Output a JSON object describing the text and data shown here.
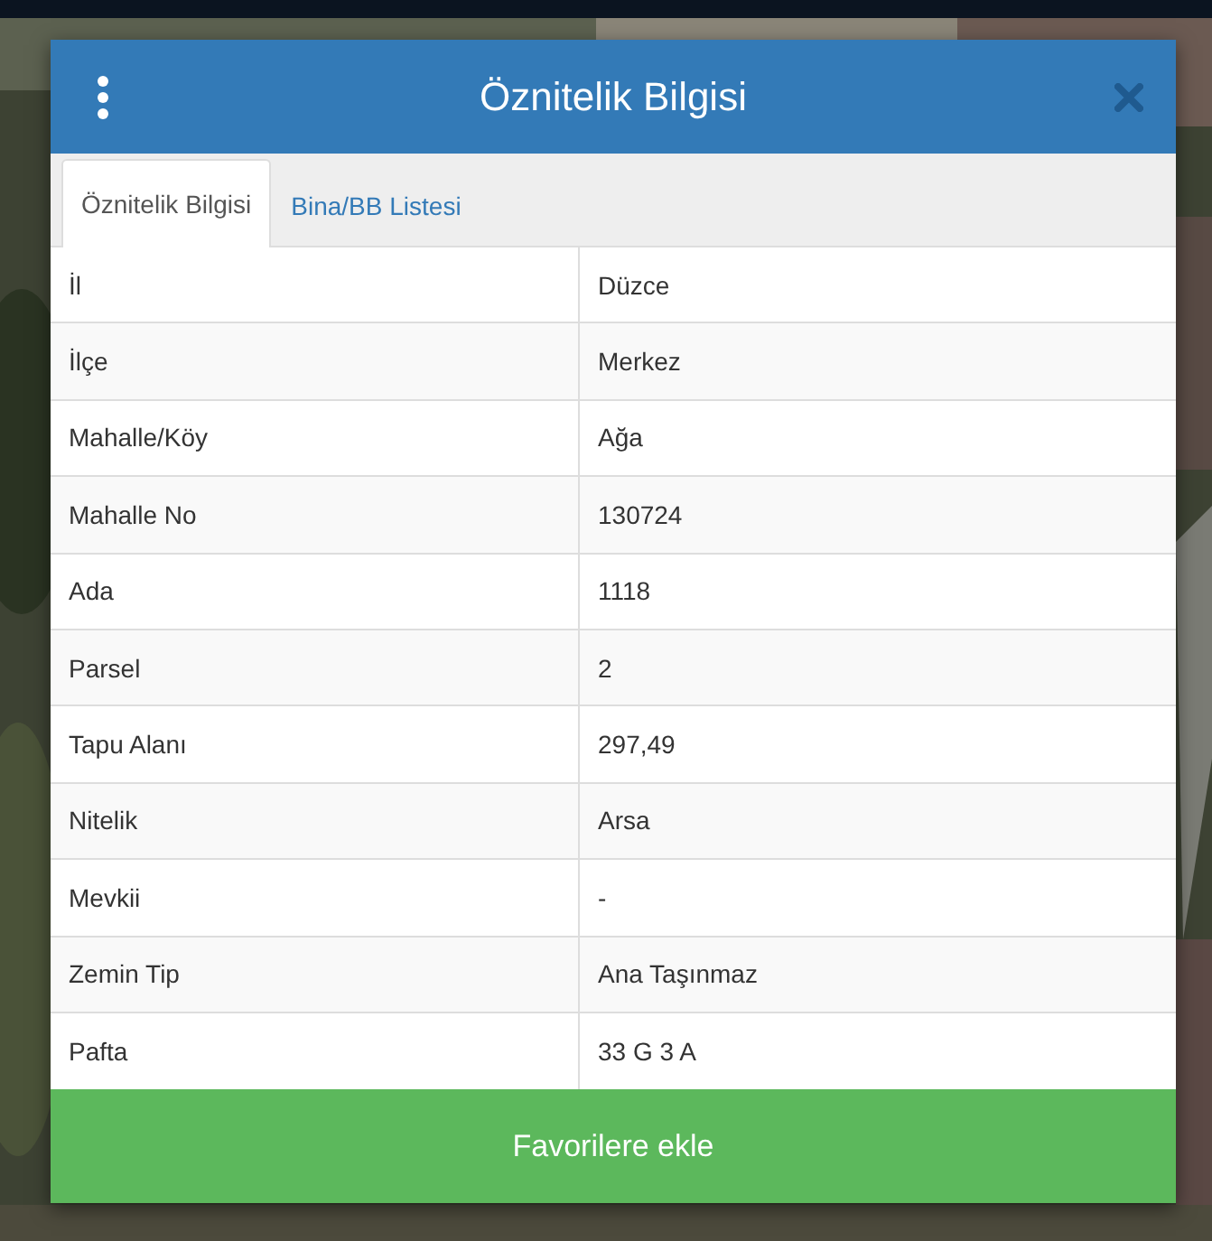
{
  "dialog": {
    "title": "Öznitelik Bilgisi",
    "tabs": [
      {
        "label": "Öznitelik Bilgisi",
        "selected": true
      },
      {
        "label": "Bina/BB Listesi",
        "selected": false
      }
    ],
    "rows": [
      {
        "label": "İl",
        "value": "Düzce"
      },
      {
        "label": "İlçe",
        "value": "Merkez"
      },
      {
        "label": "Mahalle/Köy",
        "value": "Ağa"
      },
      {
        "label": "Mahalle No",
        "value": "130724"
      },
      {
        "label": "Ada",
        "value": "1118"
      },
      {
        "label": "Parsel",
        "value": "2"
      },
      {
        "label": "Tapu Alanı",
        "value": "297,49"
      },
      {
        "label": "Nitelik",
        "value": "Arsa"
      },
      {
        "label": "Mevkii",
        "value": "-"
      },
      {
        "label": "Zemin Tip",
        "value": "Ana Taşınmaz"
      },
      {
        "label": "Pafta",
        "value": "33 G 3 A"
      }
    ],
    "button": "Favorilere ekle"
  }
}
